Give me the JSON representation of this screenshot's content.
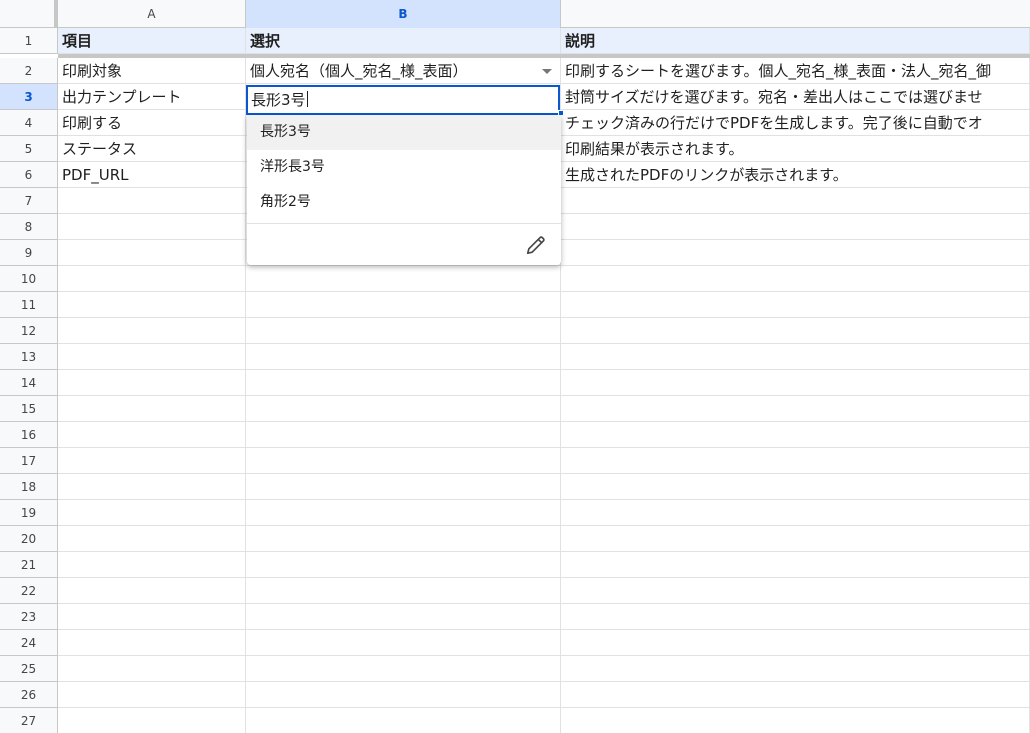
{
  "columns": [
    "A",
    "B"
  ],
  "active_column": "B",
  "rows": [
    "1",
    "2",
    "3",
    "4",
    "5",
    "6",
    "7",
    "8",
    "9",
    "10",
    "11",
    "12",
    "13",
    "14",
    "15",
    "16",
    "17",
    "18",
    "19",
    "20",
    "21",
    "22",
    "23",
    "24",
    "25",
    "26",
    "27"
  ],
  "active_row": "3",
  "header": {
    "a": "項目",
    "b": "選択",
    "c": "説明"
  },
  "cells": [
    {
      "a": "印刷対象",
      "b": "個人宛名（個人_宛名_様_表面）",
      "c": "印刷するシートを選びます。個人_宛名_様_表面・法人_宛名_御"
    },
    {
      "a": "出力テンプレート",
      "b": "",
      "c": "封筒サイズだけを選びます。宛名・差出人はここでは選びませ"
    },
    {
      "a": "印刷する",
      "b": "",
      "c": "チェック済みの行だけでPDFを生成します。完了後に自動でオ"
    },
    {
      "a": "ステータス",
      "b": "",
      "c": "印刷結果が表示されます。"
    },
    {
      "a": "PDF_URL",
      "b": "",
      "c": "生成されたPDFのリンクが表示されます。"
    }
  ],
  "editing_value": "長形3号",
  "dropdown": {
    "options": [
      "長形3号",
      "洋形長3号",
      "角形2号"
    ],
    "edit_icon": "pencil-icon"
  },
  "colors": {
    "accent": "#0b57d0",
    "header_highlight": "#d3e3fd",
    "header_row_bg": "#e8f0fe"
  }
}
